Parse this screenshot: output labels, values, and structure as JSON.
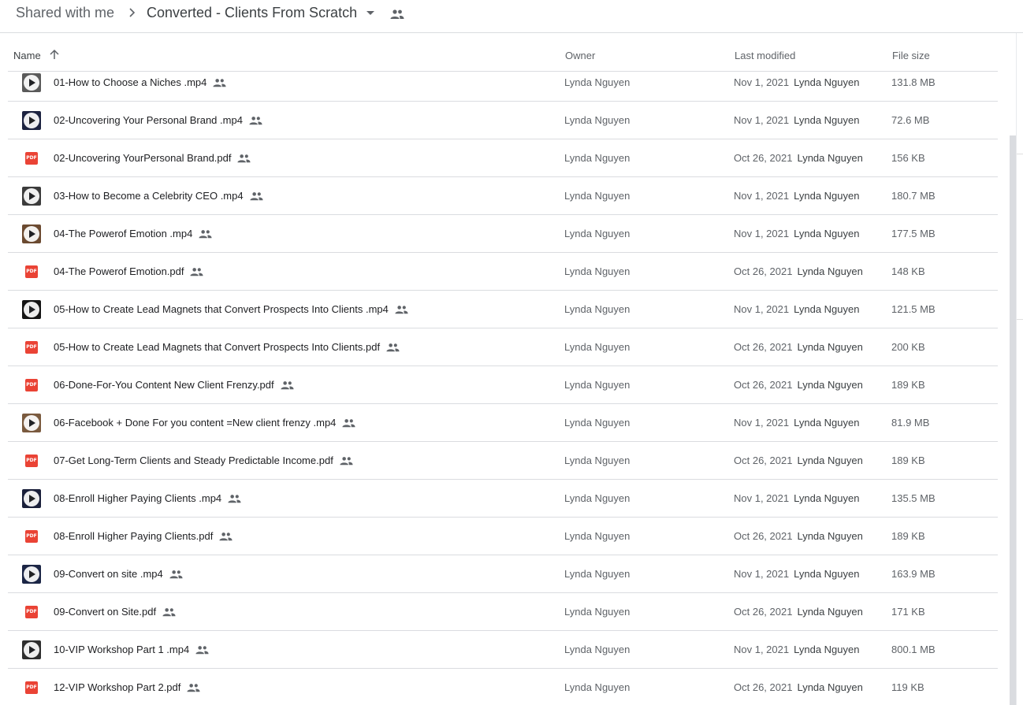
{
  "breadcrumb": {
    "root": "Shared with me",
    "current": "Converted - Clients From Scratch"
  },
  "columns": {
    "name": "Name",
    "owner": "Owner",
    "last_modified": "Last modified",
    "file_size": "File size"
  },
  "files": [
    {
      "name": "01-How to Choose a Niches  .mp4",
      "type": "video",
      "thumb": "#5a5a5a",
      "owner": "Lynda Nguyen",
      "date": "Nov 1, 2021",
      "by": "Lynda Nguyen",
      "size": "131.8 MB"
    },
    {
      "name": "02-Uncovering Your Personal Brand .mp4",
      "type": "video",
      "thumb": "#1c2240",
      "owner": "Lynda Nguyen",
      "date": "Nov 1, 2021",
      "by": "Lynda Nguyen",
      "size": "72.6 MB"
    },
    {
      "name": "02-Uncovering YourPersonal Brand.pdf",
      "type": "pdf",
      "owner": "Lynda Nguyen",
      "date": "Oct 26, 2021",
      "by": "Lynda Nguyen",
      "size": "156 KB"
    },
    {
      "name": "03-How to Become a Celebrity CEO  .mp4",
      "type": "video",
      "thumb": "#3b3b3b",
      "owner": "Lynda Nguyen",
      "date": "Nov 1, 2021",
      "by": "Lynda Nguyen",
      "size": "180.7 MB"
    },
    {
      "name": "04-The Powerof Emotion .mp4",
      "type": "video",
      "thumb": "#6b4a30",
      "owner": "Lynda Nguyen",
      "date": "Nov 1, 2021",
      "by": "Lynda Nguyen",
      "size": "177.5 MB"
    },
    {
      "name": "04-The Powerof Emotion.pdf",
      "type": "pdf",
      "owner": "Lynda Nguyen",
      "date": "Oct 26, 2021",
      "by": "Lynda Nguyen",
      "size": "148 KB"
    },
    {
      "name": "05-How to Create Lead Magnets that Convert Prospects Into Clients .mp4",
      "type": "video",
      "thumb": "#141414",
      "owner": "Lynda Nguyen",
      "date": "Nov 1, 2021",
      "by": "Lynda Nguyen",
      "size": "121.5 MB"
    },
    {
      "name": "05-How to Create Lead Magnets that Convert Prospects Into Clients.pdf",
      "type": "pdf",
      "owner": "Lynda Nguyen",
      "date": "Oct 26, 2021",
      "by": "Lynda Nguyen",
      "size": "200 KB"
    },
    {
      "name": "06-Done-For-You Content  New Client Frenzy.pdf",
      "type": "pdf",
      "owner": "Lynda Nguyen",
      "date": "Oct 26, 2021",
      "by": "Lynda Nguyen",
      "size": "189 KB"
    },
    {
      "name": "06-Facebook + Done For you content =New client frenzy .mp4",
      "type": "video",
      "thumb": "#7a5a3e",
      "owner": "Lynda Nguyen",
      "date": "Nov 1, 2021",
      "by": "Lynda Nguyen",
      "size": "81.9 MB"
    },
    {
      "name": "07-Get Long-Term Clients and Steady Predictable Income.pdf",
      "type": "pdf",
      "owner": "Lynda Nguyen",
      "date": "Oct 26, 2021",
      "by": "Lynda Nguyen",
      "size": "189 KB"
    },
    {
      "name": "08-Enroll Higher Paying Clients .mp4",
      "type": "video",
      "thumb": "#1a1f3a",
      "owner": "Lynda Nguyen",
      "date": "Nov 1, 2021",
      "by": "Lynda Nguyen",
      "size": "135.5 MB"
    },
    {
      "name": "08-Enroll Higher Paying Clients.pdf",
      "type": "pdf",
      "owner": "Lynda Nguyen",
      "date": "Oct 26, 2021",
      "by": "Lynda Nguyen",
      "size": "189 KB"
    },
    {
      "name": "09-Convert on site .mp4",
      "type": "video",
      "thumb": "#1b2545",
      "owner": "Lynda Nguyen",
      "date": "Nov 1, 2021",
      "by": "Lynda Nguyen",
      "size": "163.9 MB"
    },
    {
      "name": "09-Convert on Site.pdf",
      "type": "pdf",
      "owner": "Lynda Nguyen",
      "date": "Oct 26, 2021",
      "by": "Lynda Nguyen",
      "size": "171 KB"
    },
    {
      "name": "10-VIP Workshop Part 1 .mp4",
      "type": "video",
      "thumb": "#2e2e2e",
      "owner": "Lynda Nguyen",
      "date": "Nov 1, 2021",
      "by": "Lynda Nguyen",
      "size": "800.1 MB"
    },
    {
      "name": "12-VIP Workshop Part 2.pdf",
      "type": "pdf",
      "owner": "Lynda Nguyen",
      "date": "Oct 26, 2021",
      "by": "Lynda Nguyen",
      "size": "119 KB"
    }
  ],
  "icons": {
    "pdf_label": "PDF",
    "pdf_color": "#ea4335"
  }
}
